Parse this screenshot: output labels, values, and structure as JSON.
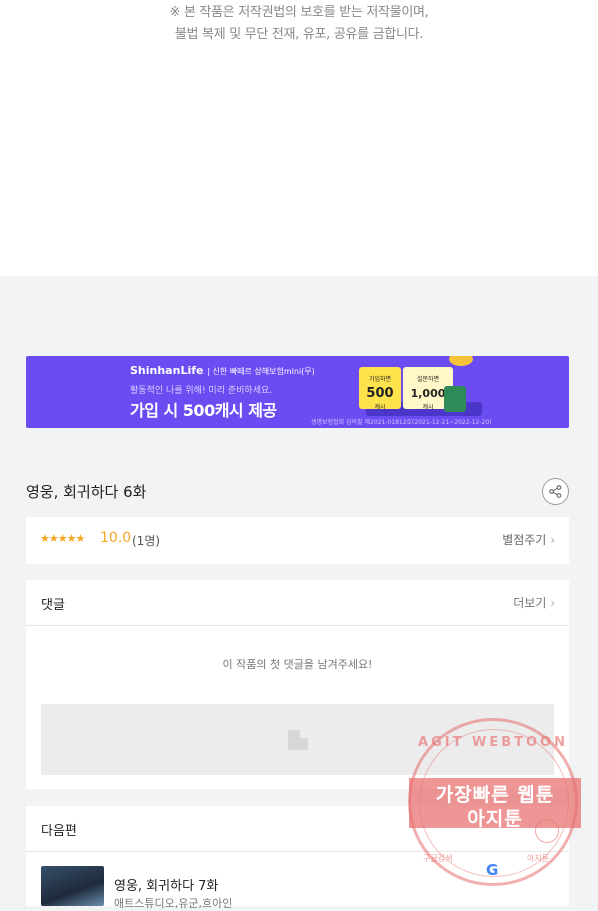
{
  "notice": {
    "line1": "※ 본 작품은 저작권법의 보호를 받는 저작물이며,",
    "line2": "불법 복제 및 무단 전재, 유포, 공유를 금합니다."
  },
  "banner": {
    "brand": "ShinhanLife",
    "brand_sub": "| 신한 빠떼르 상해보험mini(무)",
    "sub": "활동적인 나를 위해! 미리 준비하세요.",
    "main": "가입 시 500캐시 제공",
    "box1_label": "가입하면",
    "box1_value": "500",
    "box1_unit": "캐시",
    "box2_label": "설문하면",
    "box2_value": "1,000",
    "box2_unit": "캐시",
    "fine_print": "생명보험협회 심의필 제2021-01812호(2021-12-21~2022-12-20)",
    "accent": "#6a4cf2"
  },
  "episode": {
    "title": "영웅, 회귀하다 6화",
    "share_icon": "share-icon"
  },
  "rating": {
    "stars": "★★★★★",
    "score": "10.0",
    "count": "(1명)",
    "rate_button": "별점주기",
    "star_color": "#f5a623"
  },
  "comments": {
    "title": "댓글",
    "more": "더보기",
    "empty": "이 작품의 첫 댓글을 남겨주세요!"
  },
  "next": {
    "title": "다음편",
    "episode_title": "영웅, 회귀하다 7화",
    "author": "애트스튜디오,유군,흐아인"
  },
  "watermark": {
    "top": "AGIT WEBTOON",
    "line1": "가장빠른 웹툰",
    "line2": "아지툰",
    "bottom_left": "구글검색",
    "bottom_right": "아지툰",
    "g": "G"
  }
}
